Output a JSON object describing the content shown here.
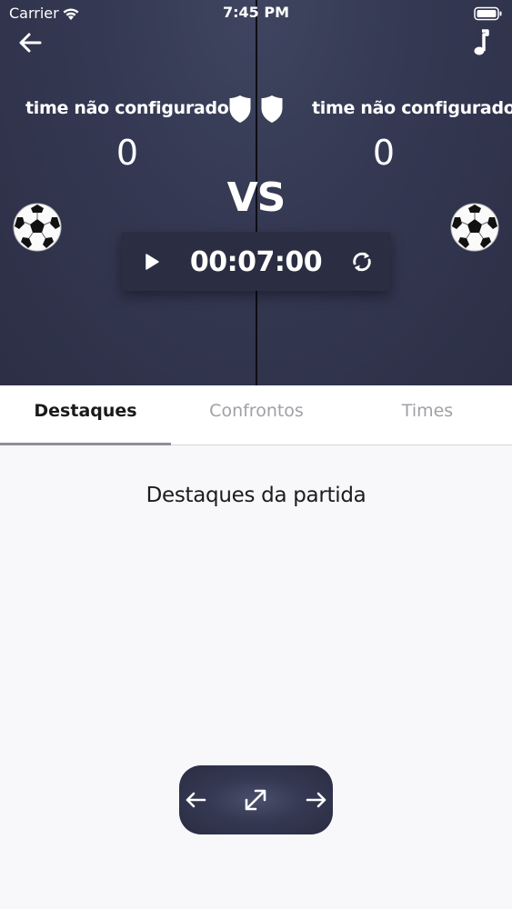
{
  "status_bar": {
    "carrier": "Carrier",
    "time": "7:45 PM",
    "icons": [
      "wifi-icon",
      "battery-icon"
    ]
  },
  "header": {
    "back_icon": "arrow-left-icon",
    "music_icon": "music-note-icon",
    "team_left": {
      "name": "time não configurado",
      "score": "0",
      "shield_icon": "shield-icon",
      "ball_icon": "soccer-ball-icon"
    },
    "team_right": {
      "name": "time não configurado",
      "score": "0",
      "shield_icon": "shield-icon",
      "ball_icon": "soccer-ball-icon"
    },
    "vs_label": "VS",
    "timer": {
      "value": "00:07:00",
      "play_icon": "play-icon",
      "reset_icon": "refresh-icon"
    }
  },
  "tabs": [
    {
      "label": "Destaques",
      "active": true
    },
    {
      "label": "Confrontos",
      "active": false
    },
    {
      "label": "Times",
      "active": false
    }
  ],
  "content": {
    "title": "Destaques da partida"
  },
  "bottom_nav": {
    "prev_icon": "arrow-left-icon",
    "expand_icon": "expand-icon",
    "next_icon": "arrow-right-icon"
  },
  "colors": {
    "header_bg": "#343852",
    "timer_bg": "#2b2e42",
    "page_bg": "#f8f8fa",
    "tab_active": "#1a1a1a",
    "tab_inactive": "#a0a0a6"
  }
}
